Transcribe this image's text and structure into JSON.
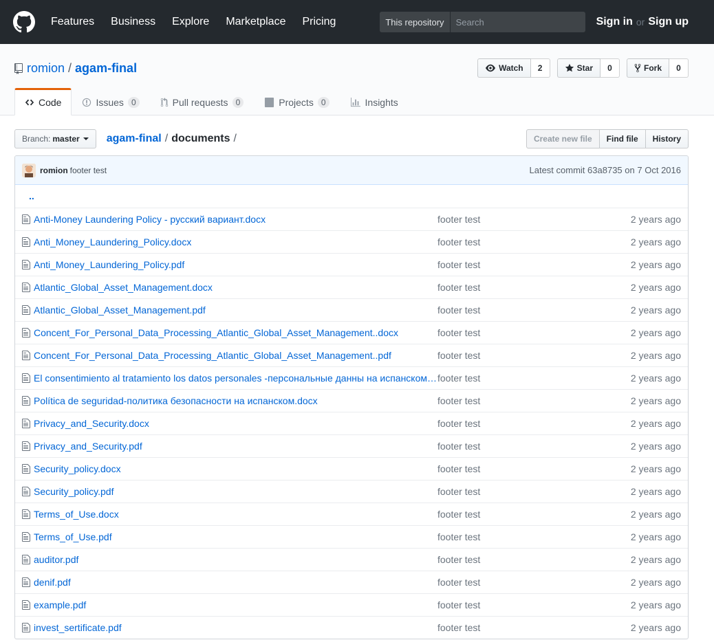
{
  "header": {
    "nav": [
      "Features",
      "Business",
      "Explore",
      "Marketplace",
      "Pricing"
    ],
    "search_scope": "This repository",
    "search_placeholder": "Search",
    "sign_in": "Sign in",
    "or": "or",
    "sign_up": "Sign up"
  },
  "repo": {
    "owner": "romion",
    "separator": "/",
    "name": "agam-final",
    "watch_label": "Watch",
    "watch_count": "2",
    "star_label": "Star",
    "star_count": "0",
    "fork_label": "Fork",
    "fork_count": "0"
  },
  "tabs": [
    {
      "label": "Code",
      "count": null
    },
    {
      "label": "Issues",
      "count": "0"
    },
    {
      "label": "Pull requests",
      "count": "0"
    },
    {
      "label": "Projects",
      "count": "0"
    },
    {
      "label": "Insights",
      "count": null
    }
  ],
  "file_nav": {
    "branch_prefix": "Branch:",
    "branch": "master",
    "crumb_root": "agam-final",
    "crumb_sep": "/",
    "crumb_current": "documents",
    "crumb_trailing": "/",
    "create_new_file": "Create new file",
    "find_file": "Find file",
    "history": "History"
  },
  "commit": {
    "author": "romion",
    "message": "footer test",
    "latest_prefix": "Latest commit",
    "sha": "63a8735",
    "date_prefix": "on",
    "date": "7 Oct 2016"
  },
  "up_link": "..",
  "files": [
    {
      "name": "Anti-Money Laundering Policy - русский вариант.docx",
      "message": "footer test",
      "age": "2 years ago"
    },
    {
      "name": "Anti_Money_Laundering_Policy.docx",
      "message": "footer test",
      "age": "2 years ago"
    },
    {
      "name": "Anti_Money_Laundering_Policy.pdf",
      "message": "footer test",
      "age": "2 years ago"
    },
    {
      "name": "Atlantic_Global_Asset_Management.docx",
      "message": "footer test",
      "age": "2 years ago"
    },
    {
      "name": "Atlantic_Global_Asset_Management.pdf",
      "message": "footer test",
      "age": "2 years ago"
    },
    {
      "name": "Concent_For_Personal_Data_Processing_Atlantic_Global_Asset_Management..docx",
      "message": "footer test",
      "age": "2 years ago"
    },
    {
      "name": "Concent_For_Personal_Data_Processing_Atlantic_Global_Asset_Management..pdf",
      "message": "footer test",
      "age": "2 years ago"
    },
    {
      "name": "El consentimiento al tratamiento los datos personales -персональные данны на испанском…",
      "message": "footer test",
      "age": "2 years ago"
    },
    {
      "name": "Política de seguridad-политика безопасности на испанском.docx",
      "message": "footer test",
      "age": "2 years ago"
    },
    {
      "name": "Privacy_and_Security.docx",
      "message": "footer test",
      "age": "2 years ago"
    },
    {
      "name": "Privacy_and_Security.pdf",
      "message": "footer test",
      "age": "2 years ago"
    },
    {
      "name": "Security_policy.docx",
      "message": "footer test",
      "age": "2 years ago"
    },
    {
      "name": "Security_policy.pdf",
      "message": "footer test",
      "age": "2 years ago"
    },
    {
      "name": "Terms_of_Use.docx",
      "message": "footer test",
      "age": "2 years ago"
    },
    {
      "name": "Terms_of_Use.pdf",
      "message": "footer test",
      "age": "2 years ago"
    },
    {
      "name": "auditor.pdf",
      "message": "footer test",
      "age": "2 years ago"
    },
    {
      "name": "denif.pdf",
      "message": "footer test",
      "age": "2 years ago"
    },
    {
      "name": "example.pdf",
      "message": "footer test",
      "age": "2 years ago"
    },
    {
      "name": "invest_sertificate.pdf",
      "message": "footer test",
      "age": "2 years ago"
    }
  ],
  "icons": {
    "logo": "github-octocat-icon",
    "repo": "repo-icon",
    "watch": "eye-icon",
    "star": "star-icon",
    "fork": "fork-icon",
    "code": "code-icon",
    "issues": "issue-icon",
    "pulls": "pull-request-icon",
    "projects": "project-icon",
    "insights": "graph-icon",
    "file": "file-icon"
  },
  "colors": {
    "header_bg": "#24292e",
    "link": "#0366d6",
    "tab_accent": "#e36209",
    "commit_bg": "#f1f8ff"
  }
}
